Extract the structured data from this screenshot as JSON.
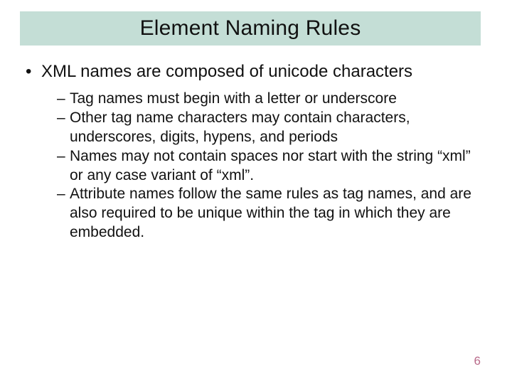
{
  "slide": {
    "title": "Element Naming Rules",
    "page_number": "6",
    "bullets": [
      {
        "text": "XML names are composed of unicode characters",
        "sub": [
          "Tag names must begin with a letter or underscore",
          "Other tag name characters may contain characters, underscores, digits, hypens, and periods",
          "Names may not contain spaces nor start with the string “xml” or any case variant of “xml”.",
          "Attribute names follow the same rules as tag names, and are also required to be unique within the tag in which they are embedded."
        ]
      }
    ]
  }
}
